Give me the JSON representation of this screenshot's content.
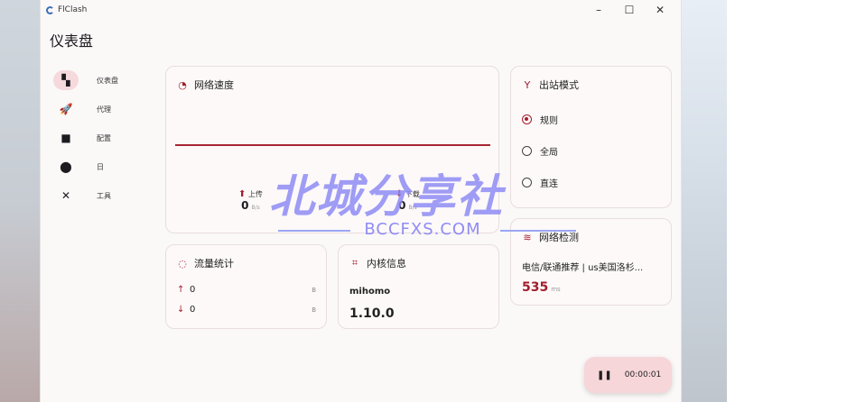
{
  "window": {
    "title": "FlClash",
    "min": "–",
    "max": "☐",
    "close": "✕"
  },
  "page_title": "仪表盘",
  "sidebar": {
    "items": [
      {
        "label": "仪表盘",
        "icon": "▚"
      },
      {
        "label": "代理",
        "icon": "🚀"
      },
      {
        "label": "配置",
        "icon": "■"
      },
      {
        "label": "日",
        "icon": "⬤"
      },
      {
        "label": "工具",
        "icon": "✕"
      }
    ]
  },
  "speed_card": {
    "title": "网络速度",
    "icon": "◔",
    "upload": {
      "label": "上传",
      "value": "0",
      "unit": "B/s"
    },
    "download": {
      "label": "下载",
      "value": "0",
      "unit": "B/s"
    }
  },
  "outbound_card": {
    "title": "出站模式",
    "icon": "Y",
    "options": [
      "规则",
      "全局",
      "直连"
    ],
    "selected": "规则"
  },
  "netcheck_card": {
    "title": "网络检测",
    "icon": "≋",
    "location": "电信/联通推荐 | us美国洛杉...",
    "latency": "535",
    "latency_unit": "ms"
  },
  "traffic_card": {
    "title": "流量统计",
    "icon": "◌",
    "rows": [
      {
        "arrow": "↑",
        "value": "0",
        "unit": "B"
      },
      {
        "arrow": "↓",
        "value": "0",
        "unit": "B"
      }
    ]
  },
  "core_card": {
    "title": "内核信息",
    "icon": "⌗",
    "name": "mihomo",
    "version": "1.10.0"
  },
  "timer": {
    "icon": "❚❚",
    "value": "00:00:01"
  },
  "watermark": {
    "main": "北城分享社",
    "sub": "BCCFXS.COM"
  },
  "colors": {
    "accent": "#a21e2d",
    "accent_bg": "#f6d9dc",
    "watermark": "#8f8cf5"
  }
}
